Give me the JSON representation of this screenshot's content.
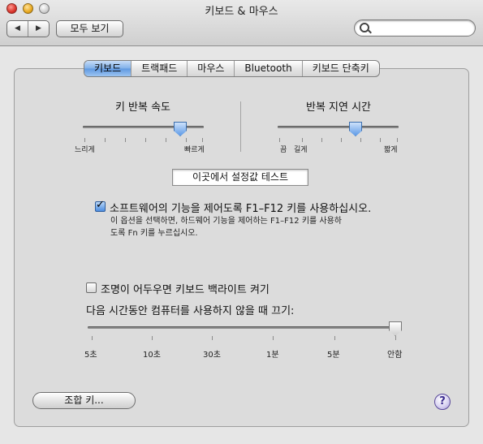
{
  "window": {
    "title": "키보드 & 마우스"
  },
  "toolbar": {
    "back_icon": "triangle-left",
    "forward_icon": "triangle-right",
    "show_all_label": "모두 보기",
    "search": {
      "value": "",
      "placeholder": ""
    }
  },
  "tabs": [
    {
      "label": "키보드",
      "active": true
    },
    {
      "label": "트랙패드",
      "active": false
    },
    {
      "label": "마우스",
      "active": false
    },
    {
      "label": "Bluetooth",
      "active": false
    },
    {
      "label": "키보드 단축키",
      "active": false
    }
  ],
  "key_repeat": {
    "title": "키 반복 속도",
    "min_label": "느리게",
    "max_label": "빠르게",
    "value": 0.75
  },
  "repeat_delay": {
    "title": "반복 지연 시간",
    "min_label_off": "끔",
    "min_label": "길게",
    "max_label": "짧게",
    "value": 0.6
  },
  "test_field": {
    "value": "이곳에서 설정값 테스트"
  },
  "fkeys": {
    "checked": true,
    "label": "소프트웨어의 기능을 제어도록 F1–F12 키를 사용하십시오.",
    "hint_line1": "이 옵션을 선택하면, 하드웨어 기능을 제어하는 F1–F12 키를 사용하",
    "hint_line2": "도록 Fn 키를 누르십시오."
  },
  "backlight": {
    "checked": false,
    "label": "조명이 어두우면 키보드 백라이트 켜기",
    "off_after_label": "다음 시간동안 컴퓨터를 사용하지 않을 때 끄기:",
    "ticks": [
      "5초",
      "10초",
      "30초",
      "1분",
      "5분",
      "안함"
    ],
    "selected": "안함"
  },
  "modifier_button": {
    "label": "조합 키..."
  },
  "help_button": {
    "label": "?"
  },
  "colors": {
    "accent": "#5f98e0",
    "background": "#e6e6e6"
  }
}
